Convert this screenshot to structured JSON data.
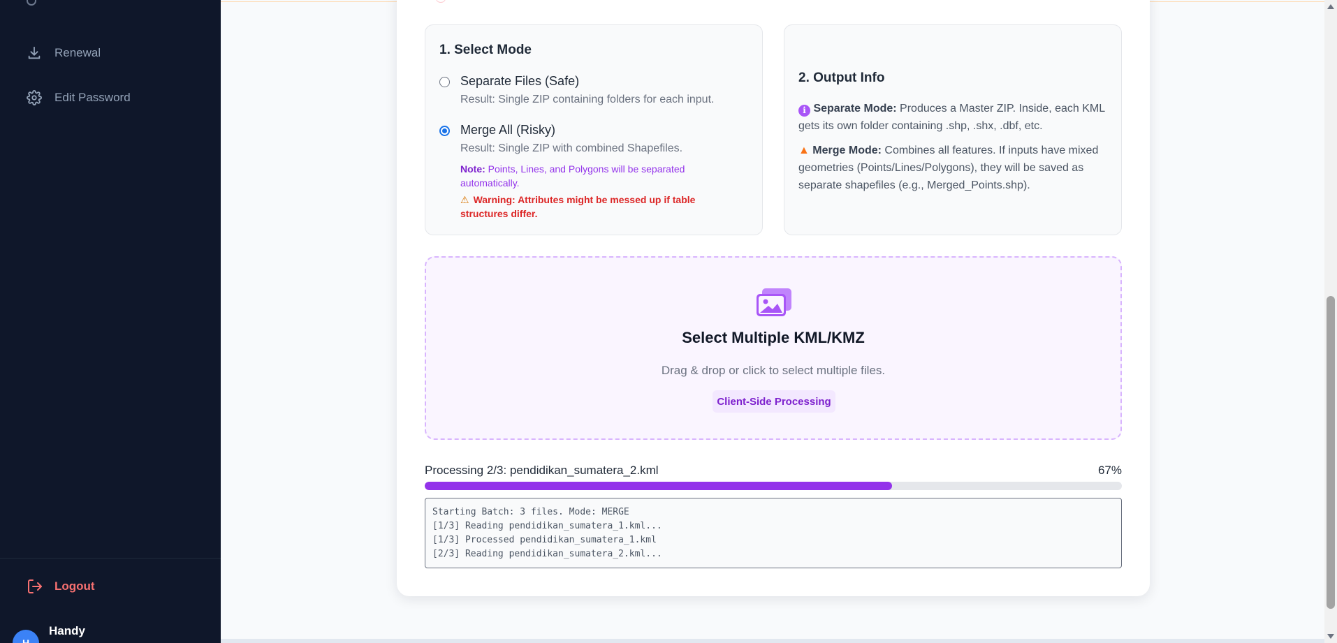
{
  "sidebar": {
    "items": [
      {
        "label": "Renewal",
        "icon": "download-icon"
      },
      {
        "label": "Edit Password",
        "icon": "gear-icon"
      }
    ],
    "logout_label": "Logout",
    "user": {
      "avatar_initial": "H",
      "name": "Handy"
    }
  },
  "mode_panel": {
    "title": "1. Select Mode",
    "options": [
      {
        "label": "Separate Files (Safe)",
        "description": "Result: Single ZIP containing folders for each input.",
        "checked": false
      },
      {
        "label": "Merge All (Risky)",
        "description": "Result: Single ZIP with combined Shapefiles.",
        "checked": true
      }
    ],
    "note_label": "Note:",
    "note_text": "Points, Lines, and Polygons will be separated automatically.",
    "warning_text": "Warning: Attributes might be messed up if table structures differ."
  },
  "info_panel": {
    "title": "2. Output Info",
    "separate_label": "Separate Mode:",
    "separate_text": "Produces a Master ZIP. Inside, each KML gets its own folder containing .shp, .shx, .dbf, etc.",
    "merge_label": "Merge Mode:",
    "merge_text": "Combines all features. If inputs have mixed geometries (Points/Lines/Polygons), they will be saved as separate shapefiles (e.g., Merged_Points.shp)."
  },
  "dropzone": {
    "icon": "images-icon",
    "title": "Select Multiple KML/KMZ",
    "subtitle": "Drag & drop or click to select multiple files.",
    "badge": "Client-Side Processing"
  },
  "progress": {
    "label": "Processing 2/3: pendidikan_sumatera_2.kml",
    "percent_text": "67%",
    "value": 0.67
  },
  "log_lines": [
    "Starting Batch: 3 files. Mode: MERGE",
    "[1/3] Reading pendidikan_sumatera_1.kml...",
    "[1/3] Processed pendidikan_sumatera_1.kml",
    "[2/3] Reading pendidikan_sumatera_2.kml..."
  ],
  "colors": {
    "sidebar_bg": "#0f172a",
    "accent_purple": "#9333ea",
    "danger": "#dc2626",
    "logout": "#f87171"
  }
}
